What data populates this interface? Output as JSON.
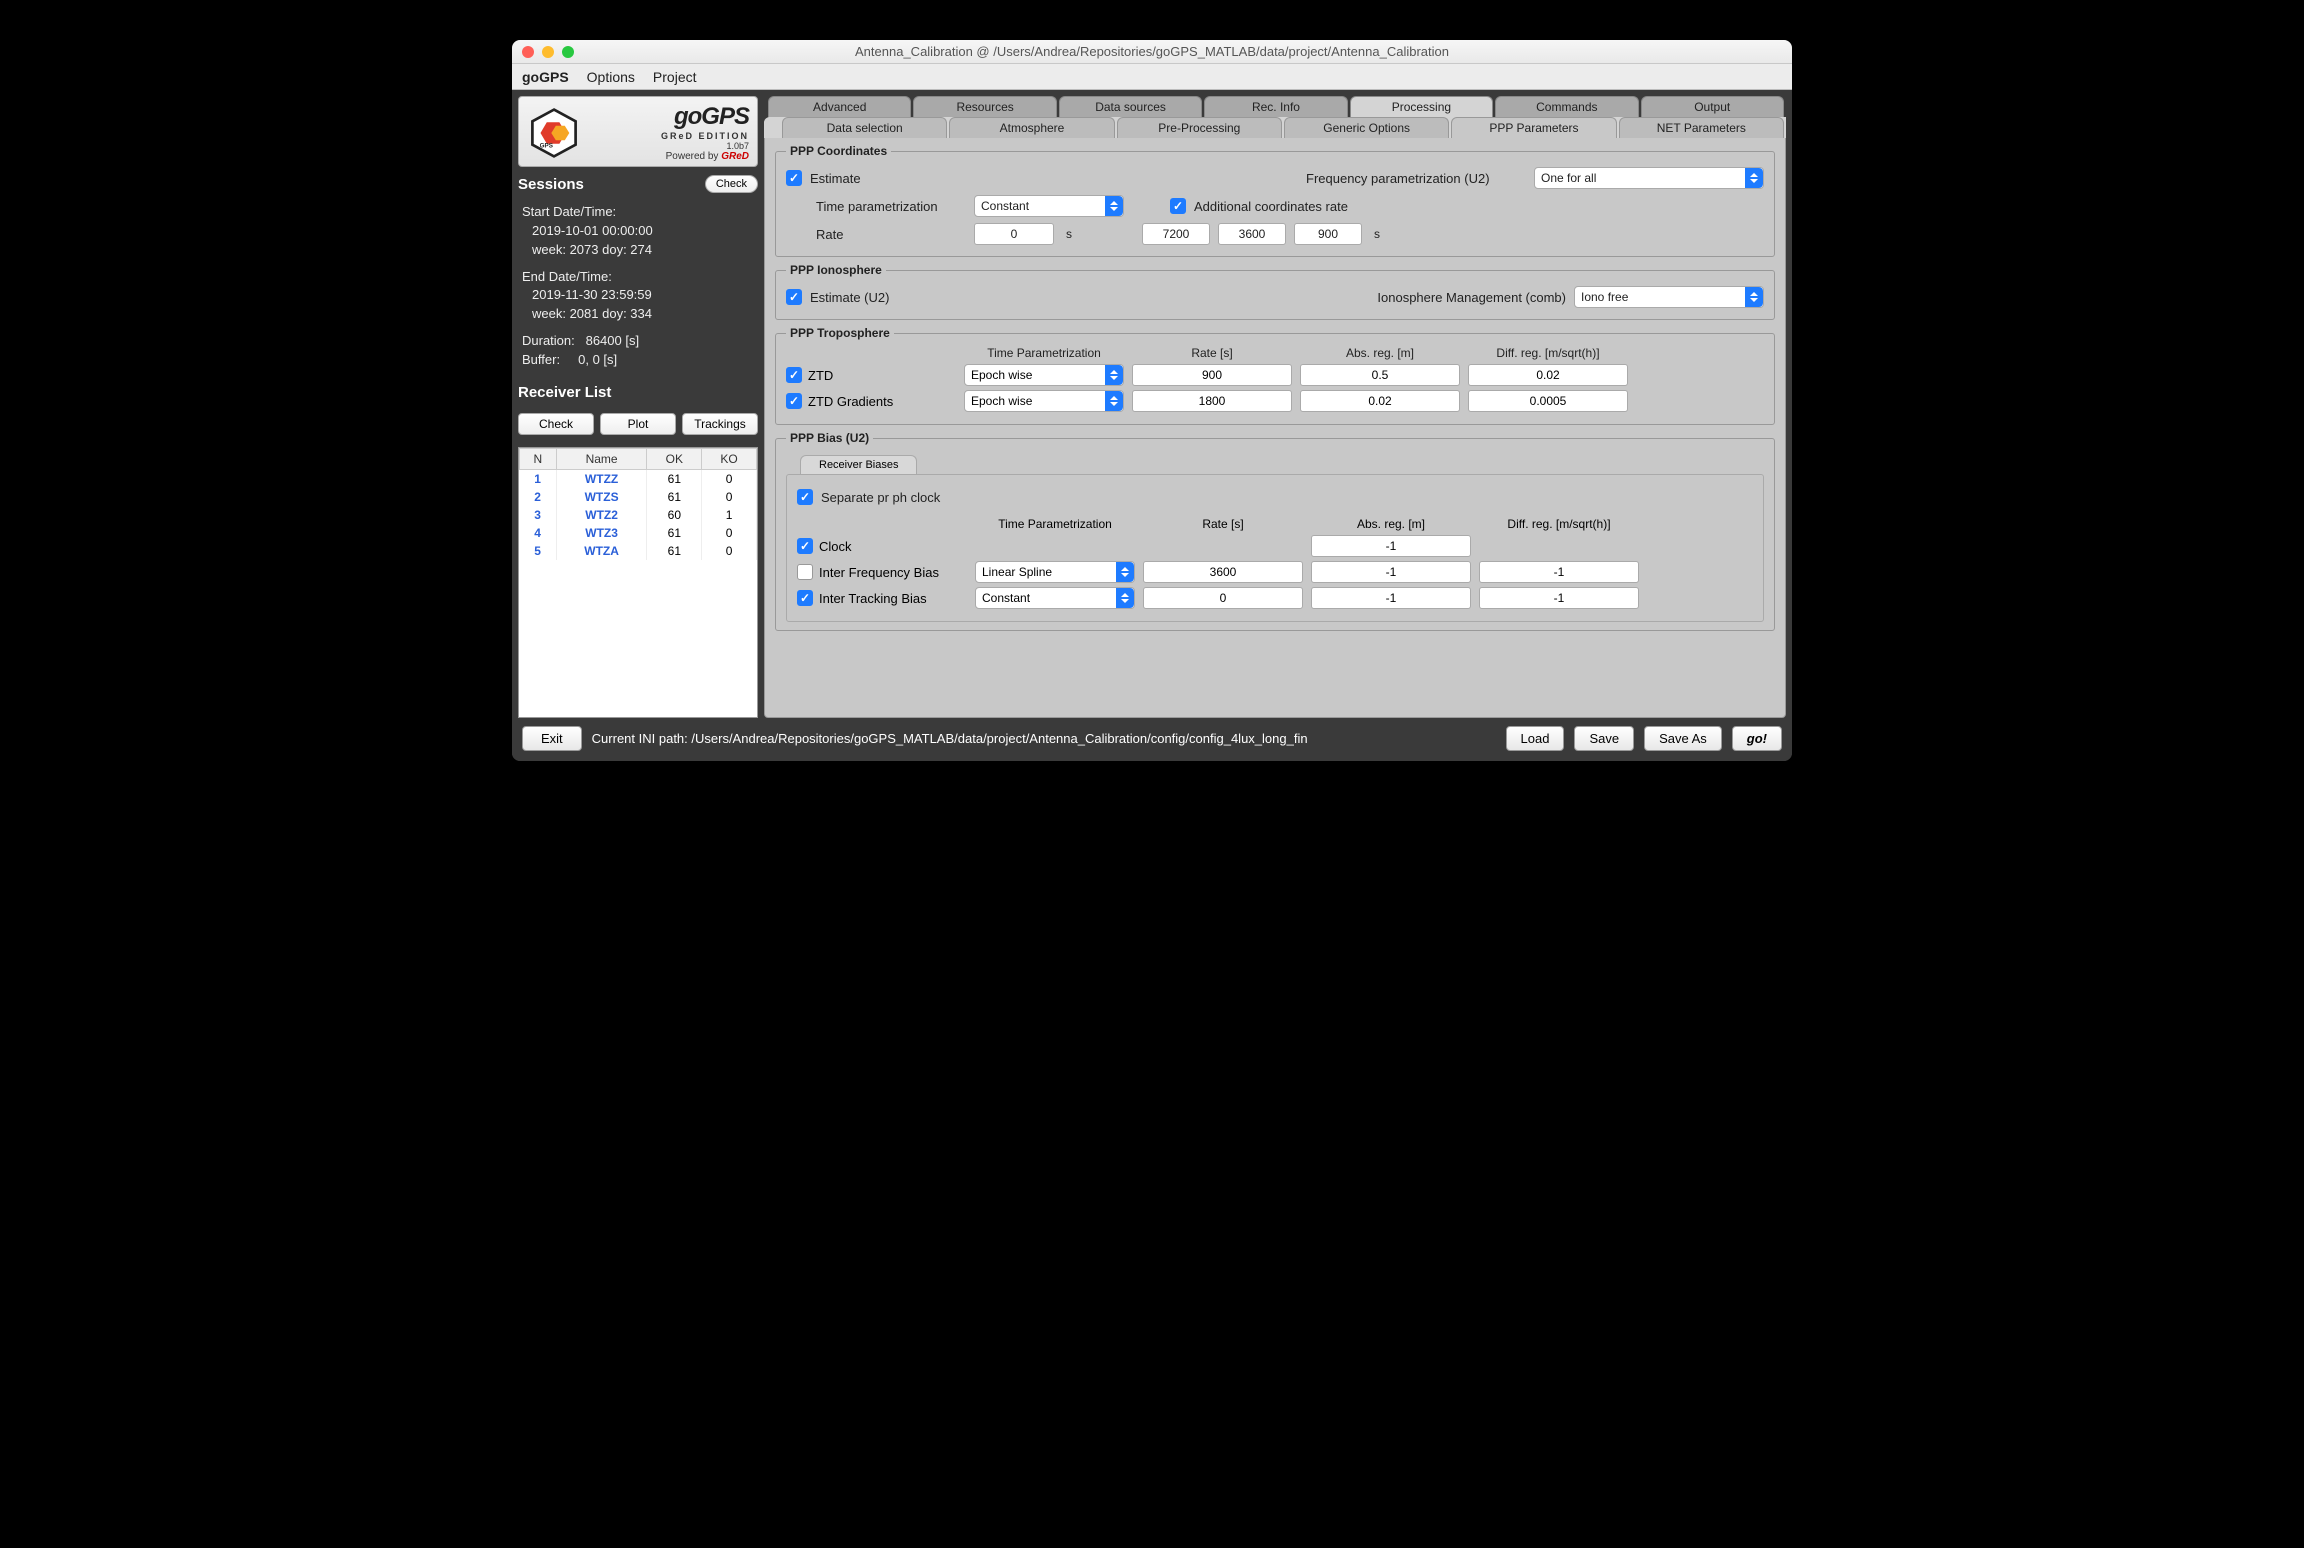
{
  "window": {
    "title": "Antenna_Calibration @ /Users/Andrea/Repositories/goGPS_MATLAB/data/project/Antenna_Calibration"
  },
  "menubar": {
    "items": [
      "goGPS",
      "Options",
      "Project"
    ]
  },
  "logo": {
    "brand": "goGPS",
    "edition": "GReD EDITION",
    "version": "1.0b7",
    "powered_prefix": "Powered by ",
    "powered_brand": "GReD"
  },
  "sidebar": {
    "sessions_label": "Sessions",
    "check_btn": "Check",
    "start_label": "Start Date/Time:",
    "start_dt": "2019-10-01  00:00:00",
    "start_wk": "week: 2073 doy: 274",
    "end_label": "End Date/Time:",
    "end_dt": "2019-11-30  23:59:59",
    "end_wk": "week: 2081 doy: 334",
    "dur_label": "Duration:",
    "dur_val": "86400 [s]",
    "buf_label": "Buffer:",
    "buf_val": "0,     0 [s]",
    "recv_label": "Receiver List",
    "check2": "Check",
    "plot": "Plot",
    "trackings": "Trackings",
    "cols": {
      "n": "N",
      "name": "Name",
      "ok": "OK",
      "ko": "KO"
    },
    "rows": [
      {
        "n": "1",
        "name": "WTZZ",
        "ok": "61",
        "ko": "0"
      },
      {
        "n": "2",
        "name": "WTZS",
        "ok": "61",
        "ko": "0"
      },
      {
        "n": "3",
        "name": "WTZ2",
        "ok": "60",
        "ko": "1"
      },
      {
        "n": "4",
        "name": "WTZ3",
        "ok": "61",
        "ko": "0"
      },
      {
        "n": "5",
        "name": "WTZA",
        "ok": "61",
        "ko": "0"
      }
    ]
  },
  "tabs": [
    "Advanced",
    "Resources",
    "Data sources",
    "Rec. Info",
    "Processing",
    "Commands",
    "Output"
  ],
  "subtabs": [
    "Data selection",
    "Atmosphere",
    "Pre-Processing",
    "Generic Options",
    "PPP Parameters",
    "NET Parameters"
  ],
  "coord": {
    "legend": "PPP Coordinates",
    "estimate": "Estimate",
    "freq_label": "Frequency parametrization (U2)",
    "freq_sel": "One for all",
    "tparam_label": "Time parametrization",
    "tparam_sel": "Constant",
    "addl": "Additional coordinates rate",
    "rate_label": "Rate",
    "rate_val": "0",
    "rate_unit": "s",
    "rates": [
      "7200",
      "3600",
      "900"
    ],
    "rates_unit": "s"
  },
  "iono": {
    "legend": "PPP Ionosphere",
    "estimate": "Estimate (U2)",
    "mgmt_label": "Ionosphere Management (comb)",
    "mgmt_sel": "Iono free"
  },
  "tropo": {
    "legend": "PPP Troposphere",
    "heads": [
      "Time Parametrization",
      "Rate [s]",
      "Abs. reg. [m]",
      "Diff. reg. [m/sqrt(h)]"
    ],
    "rows": [
      {
        "on": true,
        "label": "ZTD",
        "tp": "Epoch wise",
        "rate": "900",
        "abs": "0.5",
        "diff": "0.02"
      },
      {
        "on": true,
        "label": "ZTD Gradients",
        "tp": "Epoch wise",
        "rate": "1800",
        "abs": "0.02",
        "diff": "0.0005"
      }
    ]
  },
  "bias": {
    "legend": "PPP Bias (U2)",
    "tab": "Receiver Biases",
    "sep": "Separate pr ph clock",
    "heads": [
      "Time Parametrization",
      "Rate [s]",
      "Abs. reg. [m]",
      "Diff. reg. [m/sqrt(h)]"
    ],
    "rows": [
      {
        "on": true,
        "label": "Clock",
        "tp": "",
        "rate": "",
        "abs": "-1",
        "diff": ""
      },
      {
        "on": false,
        "label": "Inter Frequency Bias",
        "tp": "Linear Spline",
        "rate": "3600",
        "abs": "-1",
        "diff": "-1"
      },
      {
        "on": true,
        "label": "Inter Tracking Bias",
        "tp": "Constant",
        "rate": "0",
        "abs": "-1",
        "diff": "-1"
      }
    ]
  },
  "footer": {
    "exit": "Exit",
    "ini_label": "Current INI path:  ",
    "ini_path": "/Users/Andrea/Repositories/goGPS_MATLAB/data/project/Antenna_Calibration/config/config_4lux_long_fin",
    "load": "Load",
    "save": "Save",
    "saveas": "Save As",
    "go": "go!"
  }
}
